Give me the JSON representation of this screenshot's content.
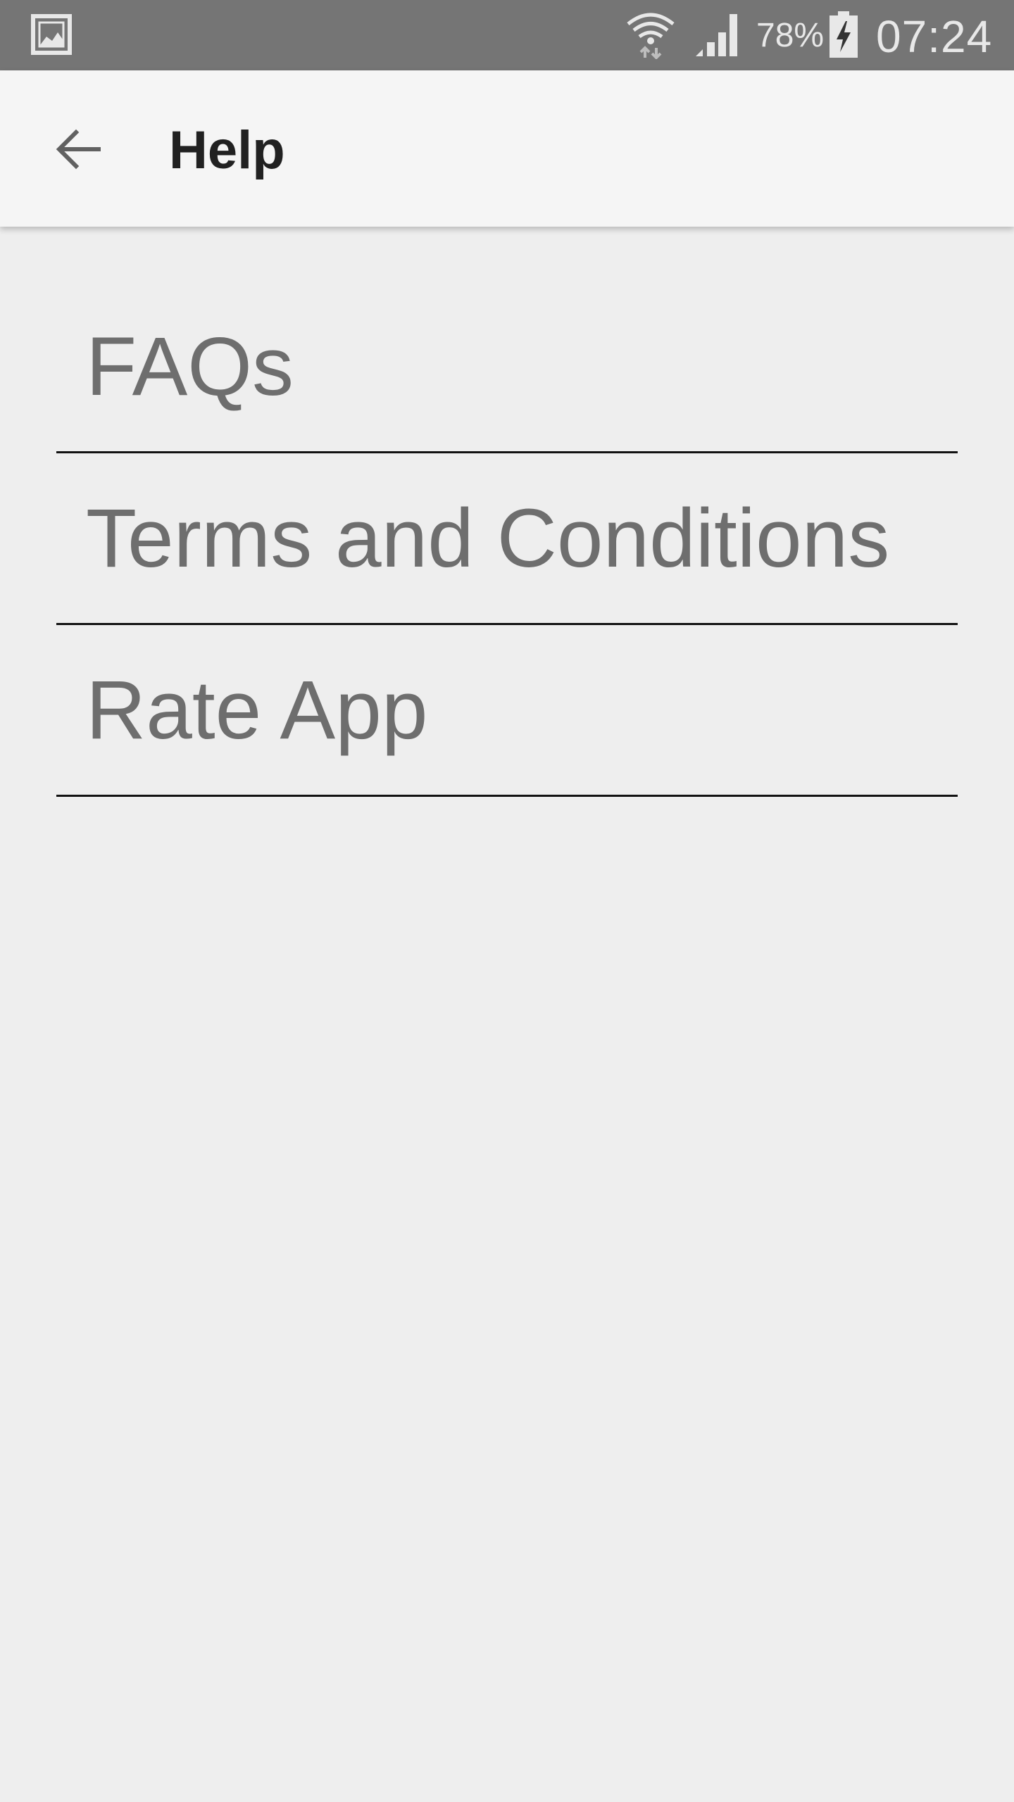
{
  "status_bar": {
    "battery_percent": "78%",
    "time": "07:24",
    "icons": [
      "gallery-icon",
      "wifi-icon",
      "signal-icon",
      "battery-charging-icon"
    ]
  },
  "app_bar": {
    "back_icon": "arrow-back-icon",
    "title": "Help"
  },
  "menu": {
    "items": [
      {
        "label": "FAQs"
      },
      {
        "label": "Terms and Conditions"
      },
      {
        "label": "Rate App"
      }
    ]
  },
  "colors": {
    "status_bar_bg": "#757575",
    "app_bar_bg": "#f5f5f5",
    "page_bg": "#eeeeee",
    "item_text": "#6e6e6e",
    "divider": "#111111"
  }
}
